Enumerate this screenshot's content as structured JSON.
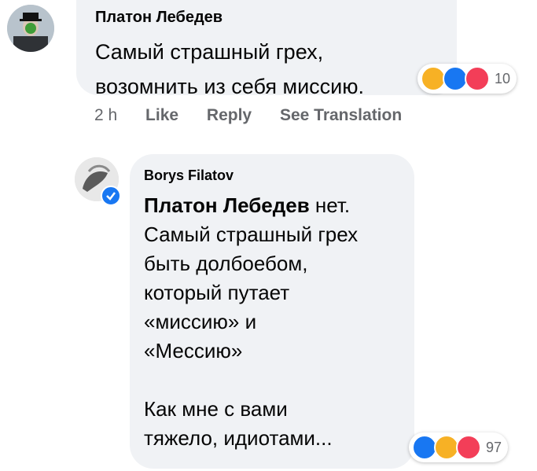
{
  "comment1": {
    "author": "Платон Лебедев",
    "text_line1": "Самый страшный грех,",
    "text_line2": "возомнить из себя миссию.",
    "reactions_count": "10",
    "reactions": [
      "haha-icon",
      "like-icon",
      "love-icon"
    ]
  },
  "actions": {
    "time": "2 h",
    "like": "Like",
    "reply": "Reply",
    "translate": "See Translation"
  },
  "comment2": {
    "author": "Borys Filatov",
    "mention": "Платон Лебедев",
    "line1_rest": " нет.",
    "line2": "Самый страшный грех",
    "line3": "быть долбоебом,",
    "line4": "который путает",
    "line5": "«миссию» и",
    "line6": "«Мессию»",
    "line7": "Как мне с вами",
    "line8": "тяжело, идиотами...",
    "reactions_count": "97",
    "reactions": [
      "like-icon",
      "haha-icon",
      "love-icon"
    ]
  },
  "colors": {
    "bubble": "#f0f2f5",
    "meta_text": "#65676b",
    "like": "#1877f2",
    "love": "#f33e58",
    "haha": "#f7b125"
  }
}
